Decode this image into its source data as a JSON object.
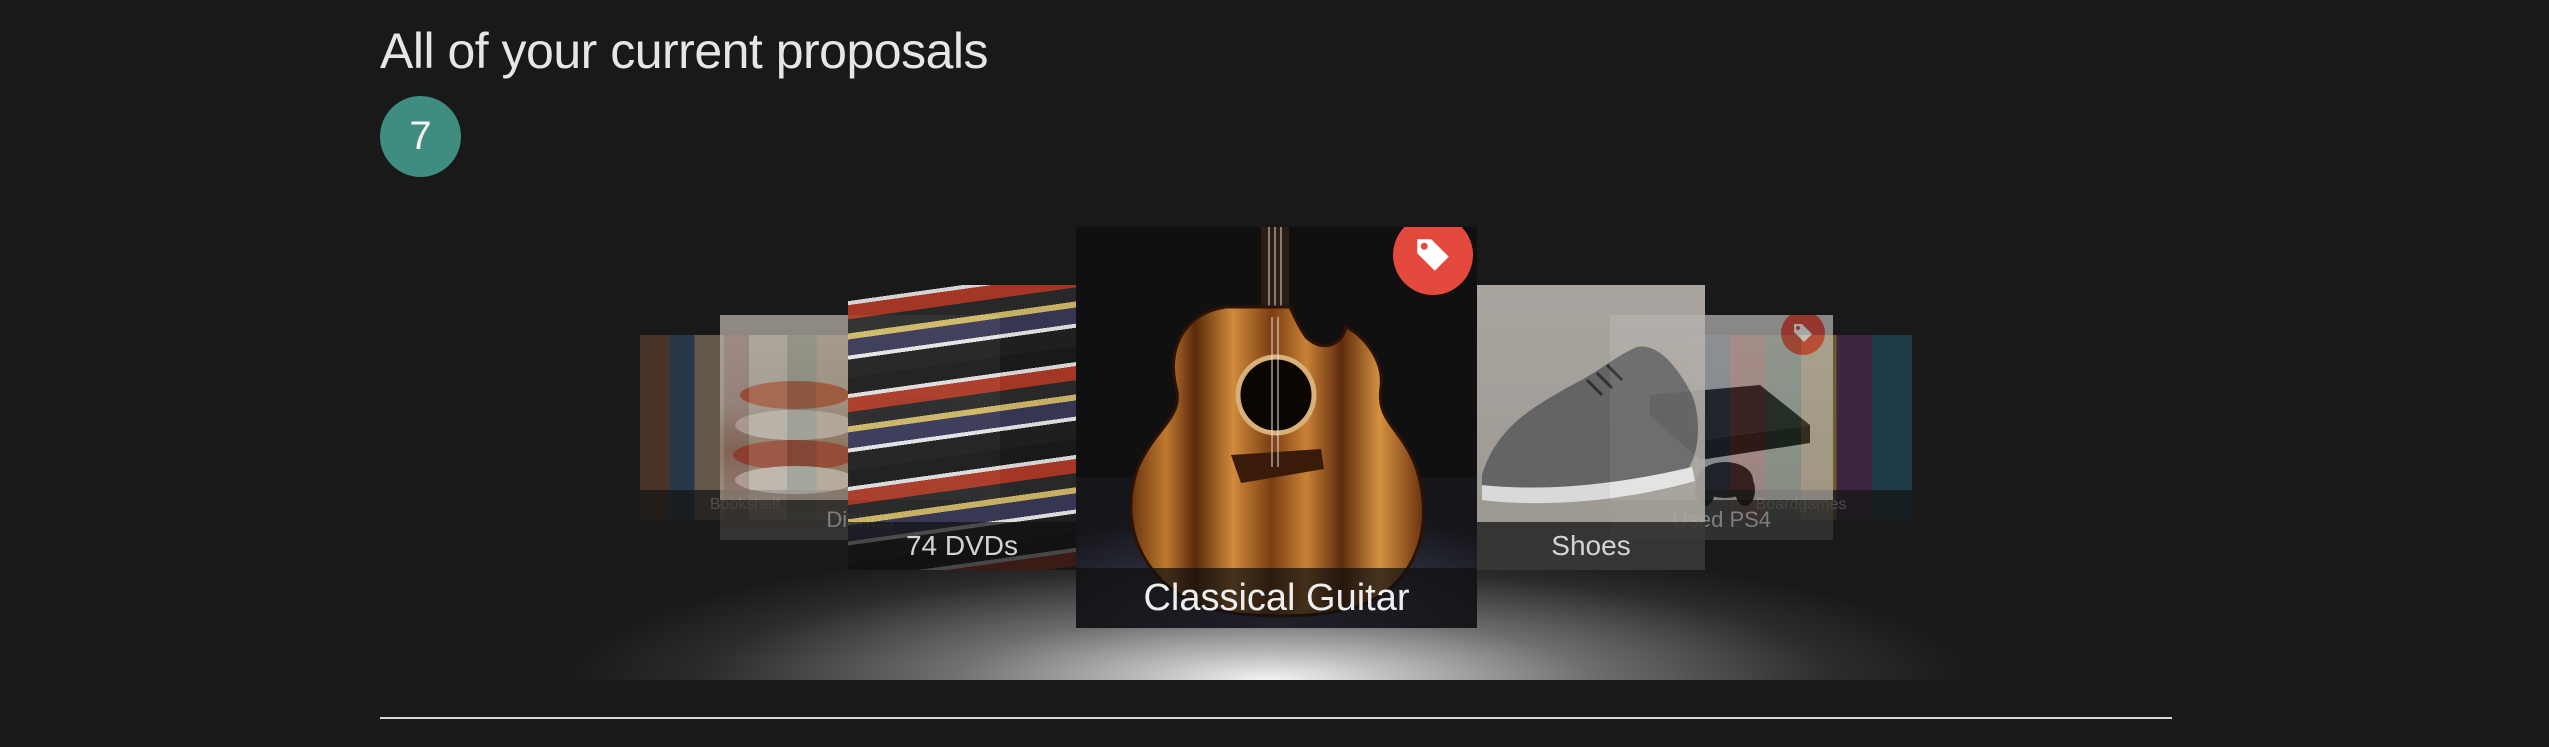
{
  "header": {
    "title": "All of your current proposals",
    "count": "7"
  },
  "carousel": {
    "items": [
      {
        "label": "Bookshelf",
        "tagged": false
      },
      {
        "label": "Dishes",
        "tagged": false
      },
      {
        "label": "74 DVDs",
        "tagged": false
      },
      {
        "label": "Classical Guitar",
        "tagged": true,
        "active": true
      },
      {
        "label": "Shoes",
        "tagged": false
      },
      {
        "label": "Used PS4",
        "tagged": true
      },
      {
        "label": "Boardgames",
        "tagged": false
      }
    ],
    "tag_icon": "price-tag-icon"
  },
  "colors": {
    "background": "#191919",
    "badge": "#3f8d80",
    "tag": "#e34a3d",
    "text": "#e6e6e6"
  }
}
